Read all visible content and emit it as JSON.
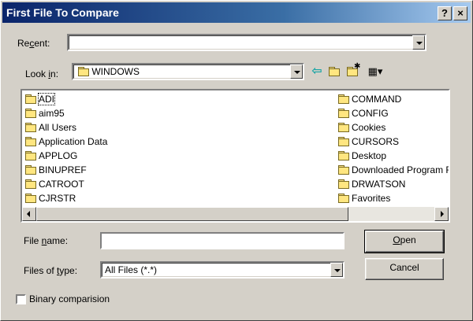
{
  "window": {
    "title": "First File To Compare",
    "help_button": "?",
    "close_button": "×"
  },
  "recent": {
    "label_prefix": "Re",
    "label_accel": "c",
    "label_suffix": "ent:",
    "value": ""
  },
  "lookin": {
    "label_prefix": "Look ",
    "label_accel": "i",
    "label_suffix": "n:",
    "value": "WINDOWS"
  },
  "toolbar": {
    "icons": [
      "back-icon",
      "up-folder-icon",
      "new-folder-icon",
      "view-menu-icon"
    ]
  },
  "files": {
    "column1": [
      "ADI",
      "aim95",
      "All Users",
      "Application Data",
      "APPLOG",
      "BINUPREF",
      "CATROOT",
      "CJRSTR"
    ],
    "column2": [
      "COMMAND",
      "CONFIG",
      "Cookies",
      "CURSORS",
      "Desktop",
      "Downloaded Program Files",
      "DRWATSON",
      "Favorites"
    ]
  },
  "filename": {
    "label_prefix": "File ",
    "label_accel": "n",
    "label_suffix": "ame:",
    "value": ""
  },
  "filetype": {
    "label_prefix": "Files of ",
    "label_accel": "t",
    "label_suffix": "ype:",
    "value": "All Files (*.*)"
  },
  "buttons": {
    "open_accel": "O",
    "open_rest": "pen",
    "cancel": "Cancel"
  },
  "binary": {
    "label": "Binary comparision",
    "checked": false
  }
}
